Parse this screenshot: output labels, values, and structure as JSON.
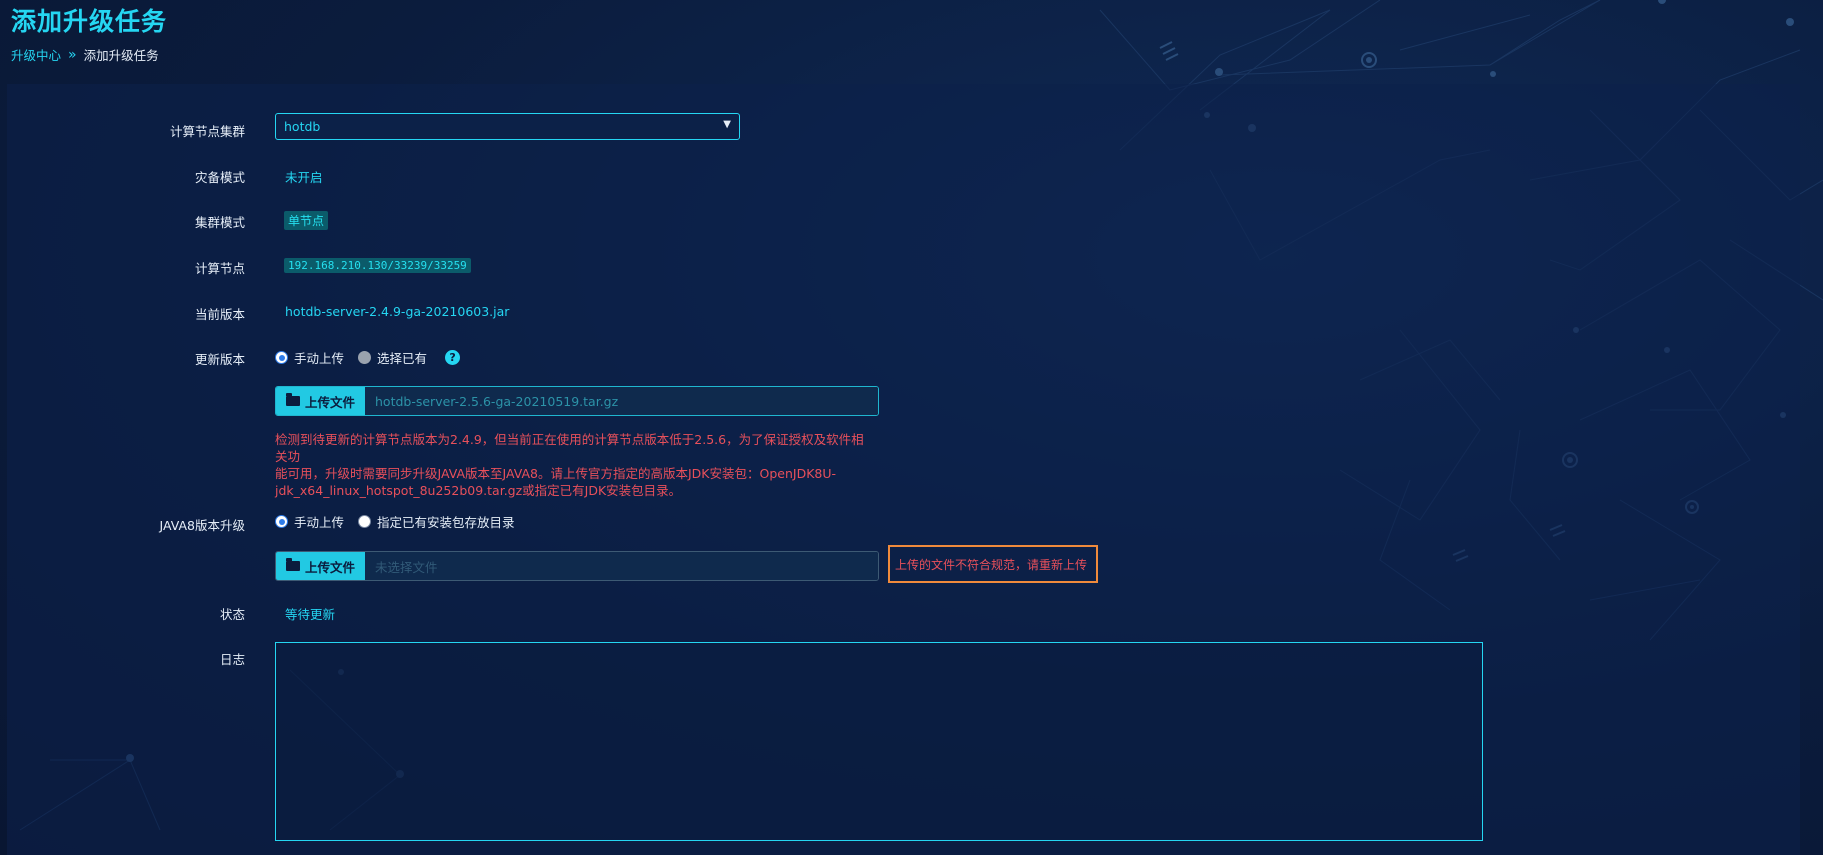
{
  "page": {
    "title": "添加升级任务",
    "breadcrumb": {
      "parent": "升级中心",
      "separator": "»",
      "current": "添加升级任务"
    }
  },
  "form": {
    "cluster": {
      "label": "计算节点集群",
      "value": "hotdb"
    },
    "dr_mode": {
      "label": "灾备模式",
      "value": "未开启"
    },
    "cluster_mode": {
      "label": "集群模式",
      "value": "单节点"
    },
    "compute_node": {
      "label": "计算节点",
      "value": "192.168.210.130/33239/33259"
    },
    "current_version": {
      "label": "当前版本",
      "value": "hotdb-server-2.4.9-ga-20210603.jar"
    },
    "update_version": {
      "label": "更新版本",
      "options": [
        "手动上传",
        "选择已有"
      ],
      "selected": "手动上传",
      "help_icon": "?"
    },
    "upload_server": {
      "button": "上传文件",
      "filename": "hotdb-server-2.5.6-ga-20210519.tar.gz"
    },
    "warning_lines": [
      "检测到待更新的计算节点版本为2.4.9，但当前正在使用的计算节点版本低于2.5.6，为了保证授权及软件相关功",
      "能可用，升级时需要同步升级JAVA版本至JAVA8。请上传官方指定的高版本JDK安装包：OpenJDK8U-",
      "jdk_x64_linux_hotspot_8u252b09.tar.gz或指定已有JDK安装包目录。"
    ],
    "java8_upgrade": {
      "label": "JAVA8版本升级",
      "options": [
        "手动上传",
        "指定已有安装包存放目录"
      ],
      "selected": "手动上传"
    },
    "upload_jdk": {
      "button": "上传文件",
      "placeholder": "未选择文件",
      "error": "上传的文件不符合规范，请重新上传"
    },
    "status": {
      "label": "状态",
      "value": "等待更新"
    },
    "log": {
      "label": "日志",
      "content": ""
    }
  },
  "colors": {
    "accent": "#25d6f2",
    "error": "#e8505b",
    "error_border": "#f08a3c",
    "background": "#0b1c3d"
  }
}
